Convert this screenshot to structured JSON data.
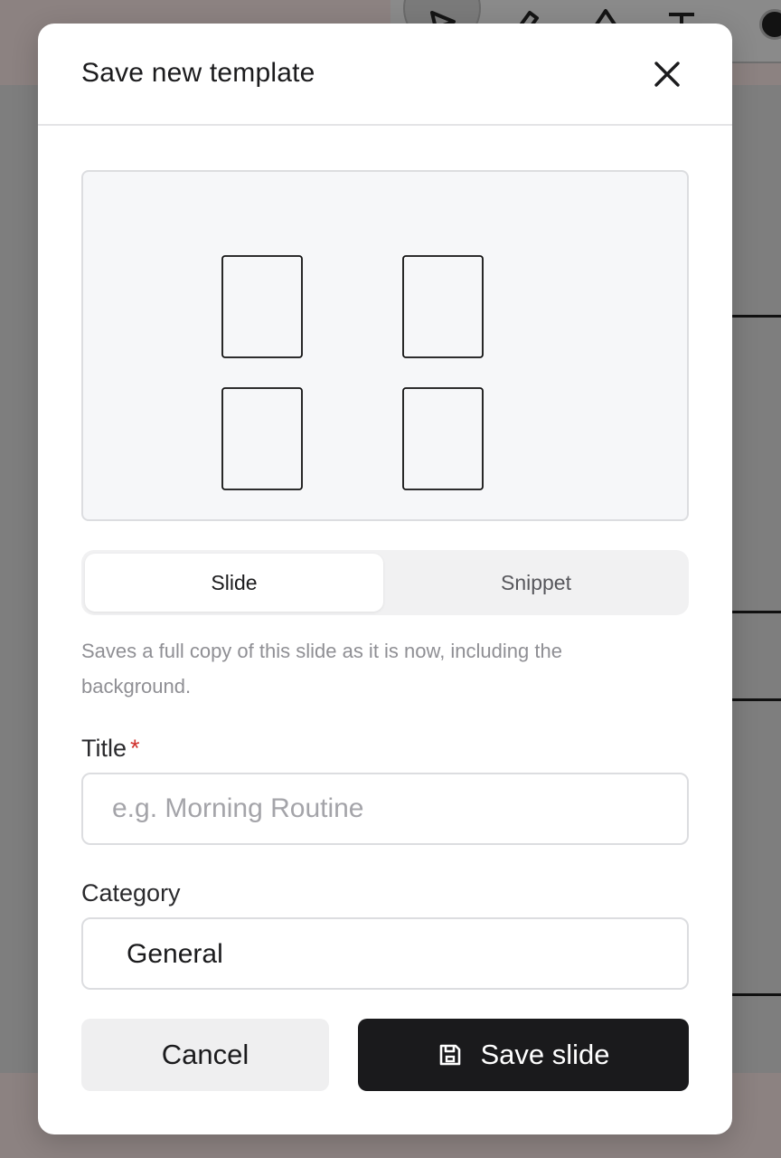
{
  "modal": {
    "title": "Save new template",
    "close_icon": "close-icon"
  },
  "preview": {
    "layout": "2x2-frames"
  },
  "segmented": {
    "options": [
      {
        "label": "Slide",
        "active": true
      },
      {
        "label": "Snippet",
        "active": false
      }
    ]
  },
  "hint": {
    "text": "Saves a full copy of this slide as it is now, including the background."
  },
  "title_field": {
    "label": "Title",
    "required_marker": "*",
    "value": "",
    "placeholder": "e.g. Morning Routine"
  },
  "category_field": {
    "label": "Category",
    "value": "General"
  },
  "actions": {
    "cancel_label": "Cancel",
    "save_label": "Save slide",
    "save_icon": "floppy-disk-icon"
  },
  "colors": {
    "primary_button": "#1a1a1c",
    "required": "#d0302c",
    "overlay": "#7c7b7b"
  }
}
